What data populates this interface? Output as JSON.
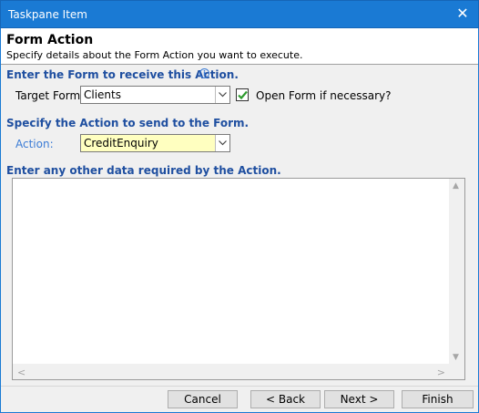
{
  "window": {
    "title": "Taskpane Item",
    "close_glyph": "✕"
  },
  "header": {
    "title": "Form Action",
    "subtitle": "Specify details about the Form Action you want to execute."
  },
  "section1": {
    "heading": "Enter the Form to receive this Action.",
    "info_glyph": "i",
    "target_label": "Target Form:",
    "target_value": "Clients",
    "open_form_label": "Open Form if necessary?",
    "open_form_checked": true
  },
  "section2": {
    "heading": "Specify the Action to send to the Form.",
    "action_label": "Action:",
    "action_value": "CreditEnquiry"
  },
  "section3": {
    "heading": "Enter any other data required by the Action.",
    "data_value": ""
  },
  "scroll": {
    "up": "▲",
    "down": "▼",
    "left": "<",
    "right": ">"
  },
  "buttons": {
    "cancel": "Cancel",
    "back": "< Back",
    "next": "Next >",
    "finish": "Finish"
  },
  "colors": {
    "titlebar": "#1a7ad4",
    "section_heading": "#1f4fa0",
    "action_field": "#ffffc0",
    "check": "#2e9b2e"
  }
}
